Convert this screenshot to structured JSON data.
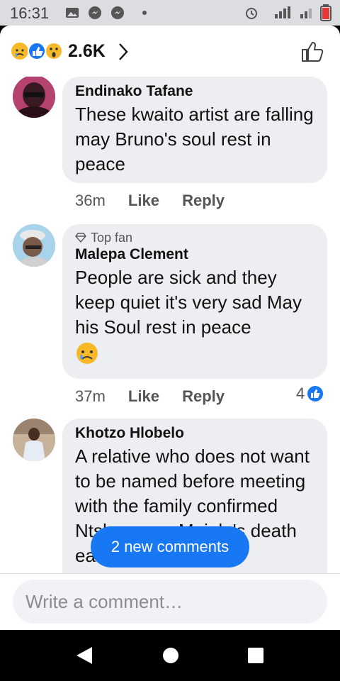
{
  "status_bar": {
    "time": "16:31"
  },
  "reactions": {
    "count": "2.6K"
  },
  "comments": [
    {
      "author": "Endinako Tafane",
      "text": "These kwaito artist are falling may Bruno's soul rest in peace",
      "time": "36m",
      "like": "Like",
      "reply": "Reply"
    },
    {
      "badge": "Top fan",
      "author": "Malepa Clement",
      "text": "People are sick and they keep quiet it's very sad May his Soul rest in peace",
      "time": "37m",
      "like": "Like",
      "reply": "Reply",
      "like_count": "4"
    },
    {
      "author": "Khotzo Hlobelo",
      "text": "A relative who does not want to be named before meeting with the family confirmed Ntshangase Mojola's death early this afternoon."
    }
  ],
  "new_comments_pill": "2 new comments",
  "composer": {
    "placeholder": "Write a comment…"
  },
  "colors": {
    "accent": "#1877f2",
    "bubble": "#eceef1",
    "status_bar": "#dcdde1"
  }
}
